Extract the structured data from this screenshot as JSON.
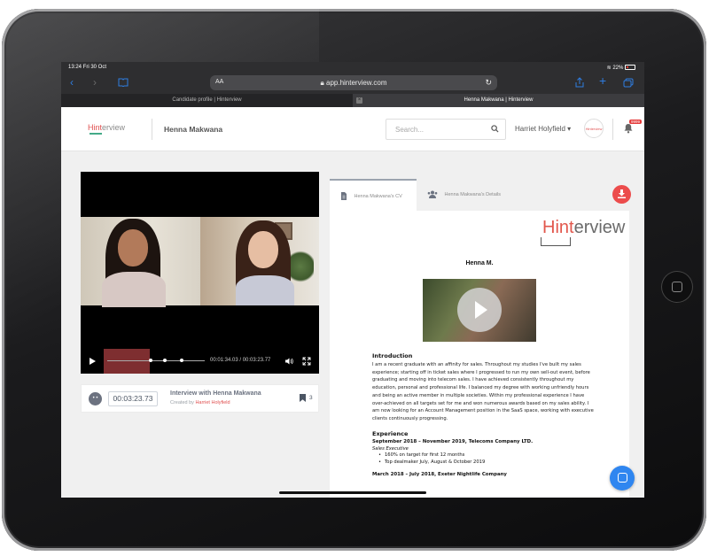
{
  "status_bar": {
    "time": "13:24  Fri 30 Oct",
    "battery": "22%"
  },
  "browser": {
    "aa_label": "AA",
    "url": "app.hinterview.com",
    "tabs": [
      {
        "label": "Candidate profile | Hinterview",
        "active": false
      },
      {
        "label": "Henna Makwana | Hinterview",
        "active": true
      }
    ]
  },
  "header": {
    "logo": {
      "hint": "Hint",
      "erview": "erview"
    },
    "candidate_name": "Henna Makwana",
    "search_placeholder": "Search...",
    "user_name": "Harriet Holyfield",
    "avatar_text": "Hinterview",
    "notification_badge": "9999"
  },
  "video": {
    "timecode": "00:01:34.03 / 00:03:23.77",
    "current_time": "00:03:23.73",
    "title": "Interview with Henna Makwana",
    "created_by_prefix": "Created by",
    "created_by": "Harriet Holyfield",
    "bookmark_count": "3"
  },
  "cv_tabs": [
    {
      "label": "Henna Makwana's CV",
      "active": true
    },
    {
      "label": "Henna Makwana's Details",
      "active": false
    }
  ],
  "cv": {
    "logo_hint": "Hint",
    "logo_rest": "erview",
    "name": "Henna M.",
    "intro_heading": "Introduction",
    "intro_text": "I am a recent graduate with an affinity for sales. Throughout my studies I've built my sales experience; starting off in ticket sales where I progressed to run my own sell-out event, before graduating and moving into telecom sales. I have achieved consistently throughout my education, personal and professional life. I balanced my degree with working unfriendly hours and being an active member in multiple societies. Within my professional experience I have over-achieved on all targets set for me and won numerous awards based on my sales ability. I am now looking for an Account Management position in the SaaS space, working with executive clients continuously progressing.",
    "experience_heading": "Experience",
    "job1_title": "September 2018 – November 2019, Telecoms Company LTD.",
    "job1_role": "Sales Executive",
    "job1_points": [
      "160% on target for first 12 months",
      "Top dealmaker July, August & October 2019"
    ],
    "job2_title": "March 2018 – July 2018, Exeter Nightlife Company"
  },
  "colors": {
    "accent": "#e05050",
    "download": "#ec4c4c",
    "chat": "#2f86f0",
    "safari_blue": "#2f7de1"
  }
}
